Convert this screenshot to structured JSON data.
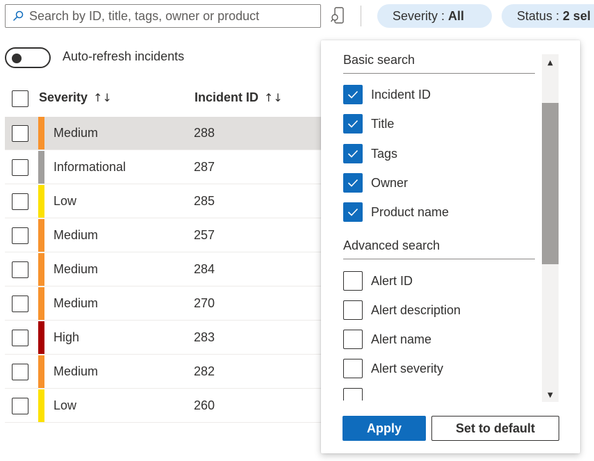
{
  "search": {
    "placeholder": "Search by ID, title, tags, owner or product"
  },
  "filters": {
    "severity_label": "Severity : ",
    "severity_value": "All",
    "status_label": "Status : ",
    "status_value": "2 sel"
  },
  "auto_refresh": {
    "label": "Auto-refresh incidents",
    "enabled": false
  },
  "table": {
    "columns": [
      {
        "label": "Severity",
        "sort": "↑↓"
      },
      {
        "label": "Incident ID",
        "sort": "↑↓"
      }
    ],
    "rows": [
      {
        "severity": "Medium",
        "id": "288",
        "color": "#f7922d",
        "selected": true
      },
      {
        "severity": "Informational",
        "id": "287",
        "color": "#a19f9d"
      },
      {
        "severity": "Low",
        "id": "285",
        "color": "#fce100"
      },
      {
        "severity": "Medium",
        "id": "257",
        "color": "#f7922d"
      },
      {
        "severity": "Medium",
        "id": "284",
        "color": "#f7922d"
      },
      {
        "severity": "Medium",
        "id": "270",
        "color": "#f7922d"
      },
      {
        "severity": "High",
        "id": "283",
        "color": "#a80000"
      },
      {
        "severity": "Medium",
        "id": "282",
        "color": "#f7922d"
      },
      {
        "severity": "Low",
        "id": "260",
        "color": "#fce100"
      }
    ]
  },
  "panel": {
    "basic_title": "Basic search",
    "basic_options": [
      {
        "label": "Incident ID",
        "checked": true
      },
      {
        "label": "Title",
        "checked": true
      },
      {
        "label": "Tags",
        "checked": true
      },
      {
        "label": "Owner",
        "checked": true
      },
      {
        "label": "Product name",
        "checked": true
      }
    ],
    "advanced_title": "Advanced search",
    "advanced_options": [
      {
        "label": "Alert ID",
        "checked": false
      },
      {
        "label": "Alert description",
        "checked": false
      },
      {
        "label": "Alert name",
        "checked": false
      },
      {
        "label": "Alert severity",
        "checked": false
      }
    ],
    "apply_label": "Apply",
    "default_label": "Set to default"
  },
  "colors": {
    "accent": "#0f6cbd",
    "pill_bg": "#deecf9"
  }
}
